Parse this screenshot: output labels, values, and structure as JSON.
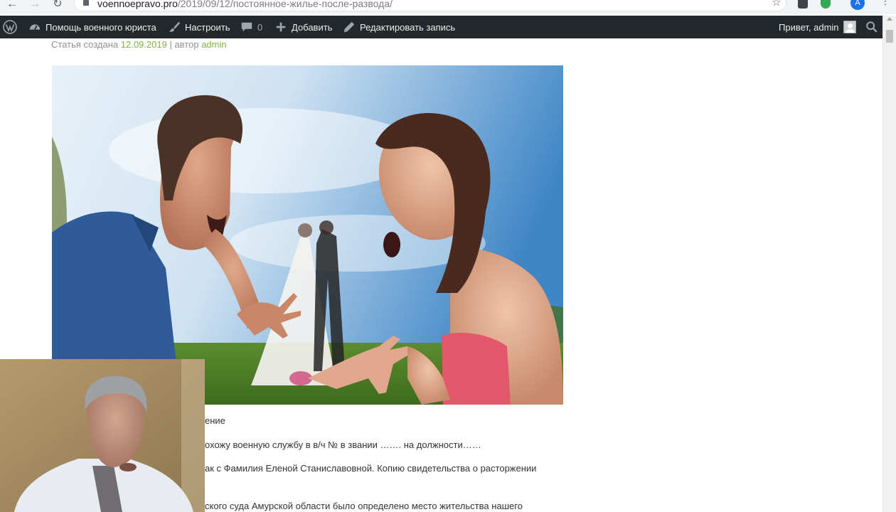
{
  "browser": {
    "url_domain": "voennoepravo.pro",
    "url_path": "/2019/09/12/постоянное-жилье-после-развода/",
    "profile_initial": "A"
  },
  "admin_bar": {
    "site_name": "Помощь военного юриста",
    "customize": "Настроить",
    "comments_count": "0",
    "add_new": "Добавить",
    "edit_post": "Редактировать запись",
    "greeting": "Привет, admin"
  },
  "article": {
    "meta_prefix": "Статья создана ",
    "meta_date": "12.09.2019",
    "meta_sep": " | автор ",
    "meta_author": "admin",
    "lines": [
      "ение",
      "охожу военную службу в в/ч № в звании ……. на должности……",
      "ак с  Фамилия Еленой Станиславовной. Копию свидетельства о расторжении",
      "ского суда Амурской области было определено место жительства нашего"
    ]
  },
  "colors": {
    "admin_bar_bg": "#23282d",
    "link_green": "#81b441"
  }
}
